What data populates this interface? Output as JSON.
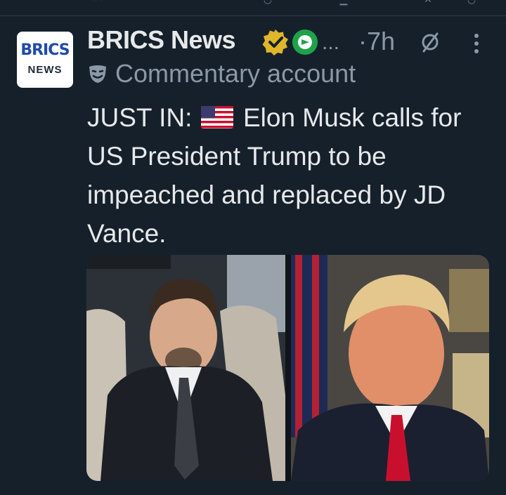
{
  "account": {
    "avatar_line1": "BRICS",
    "avatar_line2": "NEWS",
    "display_name": "BRICS News",
    "overflow": "...",
    "time": "·7h",
    "label": "Commentary account"
  },
  "tweet": {
    "prefix": "JUST IN:",
    "flag_icon": "us-flag-emoji",
    "body": "Elon Musk calls for US President Trump to be impeached and replaced by JD Vance."
  },
  "media": {
    "images": [
      "person-in-suit-car-seat-photo",
      "person-in-suit-flag-background-photo"
    ]
  },
  "colors": {
    "background": "#15202b",
    "text": "#e7e9ea",
    "muted": "#8b98a5",
    "gold_badge": "#e0b62b",
    "green_badge": "#1fa34a"
  }
}
